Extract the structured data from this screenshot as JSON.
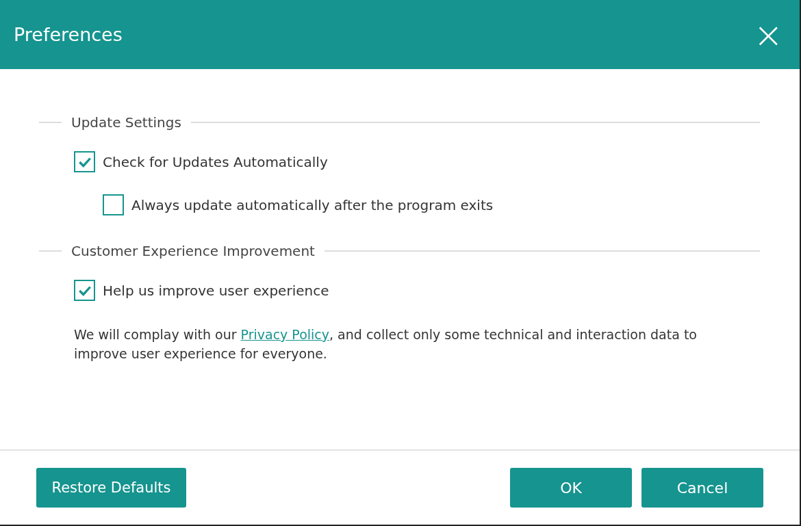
{
  "window": {
    "title": "Preferences",
    "close": "×"
  },
  "sections": [
    {
      "title": "Update Settings",
      "options": [
        {
          "label": "Check for Updates Automatically",
          "checked": true,
          "children": [
            {
              "label": "Always update automatically after the program exits",
              "checked": false
            }
          ]
        }
      ]
    },
    {
      "title": "Customer Experience Improvement",
      "options": [
        {
          "label": "Help us improve user experience",
          "checked": true
        }
      ],
      "note": {
        "before": "We will complay with our ",
        "link": "Privacy Policy",
        "after": ", and collect only some technical and interaction data to improve user experience for everyone."
      }
    }
  ],
  "buttons": [
    {
      "label": "Restore Defaults",
      "kind": "left"
    },
    {
      "label": "OK",
      "kind": "right"
    },
    {
      "label": "Cancel",
      "kind": "right"
    }
  ]
}
